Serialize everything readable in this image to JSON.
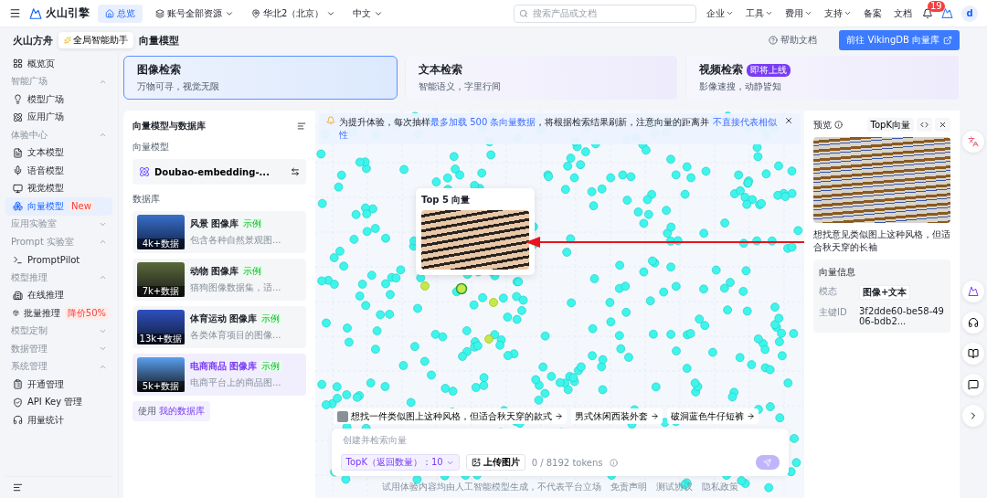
{
  "topbar": {
    "logo": "火山引擎",
    "home_tab": "总览",
    "account": "账号全部资源",
    "region": "华北2（北京）",
    "language": "中文",
    "search_placeholder": "搜索产品或文档",
    "nav": [
      {
        "label": "企业",
        "kind": "menu"
      },
      {
        "label": "工具",
        "kind": "menu"
      },
      {
        "label": "费用",
        "kind": "menu"
      },
      {
        "label": "支持",
        "kind": "menu"
      },
      {
        "label": "备案",
        "kind": "link"
      },
      {
        "label": "文档",
        "kind": "link"
      }
    ],
    "notifications": "19",
    "avatar": "d"
  },
  "header": {
    "product": "火山方舟",
    "assistant": "全局智能助手",
    "page_title": "向量模型",
    "help": "帮助文档",
    "cta": "前往 VikingDB 向量库"
  },
  "sidebar": {
    "items": [
      {
        "kind": "link",
        "label": "概览页",
        "selected": false
      },
      {
        "kind": "section",
        "label": "智能广场",
        "expanded": true,
        "children": [
          {
            "label": "模型广场",
            "selected": false
          },
          {
            "label": "应用广场",
            "selected": false
          }
        ]
      },
      {
        "kind": "section",
        "label": "体验中心",
        "expanded": true,
        "children": [
          {
            "label": "文本模型",
            "selected": false
          },
          {
            "label": "语音模型",
            "selected": false
          },
          {
            "label": "视觉模型",
            "selected": false
          },
          {
            "label": "向量模型",
            "badge": "New",
            "selected": true
          }
        ]
      },
      {
        "kind": "section",
        "label": "应用实验室",
        "expanded": false
      },
      {
        "kind": "section",
        "label": "Prompt 实验室",
        "expanded": true,
        "children": [
          {
            "label": "PromptPilot",
            "selected": false
          }
        ]
      },
      {
        "kind": "section",
        "label": "模型推理",
        "expanded": true,
        "children": [
          {
            "label": "在线推理",
            "selected": false
          },
          {
            "label": "批量推理",
            "badge": "降价50%",
            "selected": false
          }
        ]
      },
      {
        "kind": "section",
        "label": "模型定制",
        "expanded": false
      },
      {
        "kind": "section",
        "label": "数据管理",
        "expanded": false
      },
      {
        "kind": "section",
        "label": "系统管理",
        "expanded": true,
        "children": [
          {
            "label": "开通管理",
            "selected": false
          },
          {
            "label": "API Key 管理",
            "selected": false
          },
          {
            "label": "用量统计",
            "selected": false
          }
        ]
      }
    ]
  },
  "modes": [
    {
      "title": "图像检索",
      "subtitle": "万物可寻，视觉无限",
      "selected": true
    },
    {
      "title": "文本检索",
      "subtitle": "智能语义，字里行间",
      "selected": false
    },
    {
      "title": "视频检索",
      "badge": "即将上线",
      "subtitle": "影像速搜，动静皆知",
      "selected": false
    }
  ],
  "library": {
    "title": "向量模型与数据库",
    "model_label": "向量模型",
    "model": "Doubao-embedding-...",
    "db_label": "数据库",
    "databases": [
      {
        "name": "风景",
        "type": "图像库",
        "tag": "示例",
        "description": "包含各种自然景观图...",
        "count": "4k+数据",
        "selected": false
      },
      {
        "name": "动物",
        "type": "图像库",
        "tag": "示例",
        "description": "猫狗图像数据集，适...",
        "count": "7k+数据",
        "selected": false
      },
      {
        "name": "体育运动",
        "type": "图像库",
        "tag": "示例",
        "description": "各类体育项目的图像...",
        "count": "13k+数据",
        "selected": false
      },
      {
        "name": "电商商品",
        "type": "图像库",
        "tag": "示例",
        "description": "电商平台上的商品图...",
        "count": "5k+数据",
        "selected": true
      }
    ],
    "footer_text": "使用",
    "footer_link": "我的数据库"
  },
  "canvas": {
    "notice": [
      {
        "text": "为提升体验，每次抽样",
        "highlight": false
      },
      {
        "text": "最多加载 500 条向量数据",
        "highlight": true
      },
      {
        "text": "，将根据检索结果刷新，注意向量的距离并 ",
        "highlight": false
      },
      {
        "text": "不直接代表相似性",
        "highlight": true
      }
    ],
    "popup_title": "Top 5 向量",
    "suggestions": [
      {
        "text": "想找一件类似图上这种风格，但适合秋天穿的款式",
        "kind": "image"
      },
      {
        "text": "男式休闲西装外套",
        "kind": "text"
      },
      {
        "text": "破洞蓝色牛仔短裤",
        "kind": "text"
      }
    ],
    "input_placeholder": "创建并检索向量",
    "topk": "TopK（返回数量）：10",
    "upload": "上传图片",
    "tokens": "0 / 8192 tokens",
    "footer": [
      "试用体验内容均由人工智能模型生成，不代表平台立场",
      "免责声明",
      "测试协议",
      "隐私政策"
    ]
  },
  "preview": {
    "title": "预览",
    "topk_button": "TopK向量",
    "caption": "想找意见类似图上这种风格，但适合秋天穿的长袖",
    "info_title": "向量信息",
    "fields": [
      {
        "label": "模态",
        "value": "图像+文本",
        "kind": "tag"
      },
      {
        "label": "主键ID",
        "value": "3f2dde60-be58-4906-bdb2...",
        "kind": "text"
      }
    ]
  }
}
